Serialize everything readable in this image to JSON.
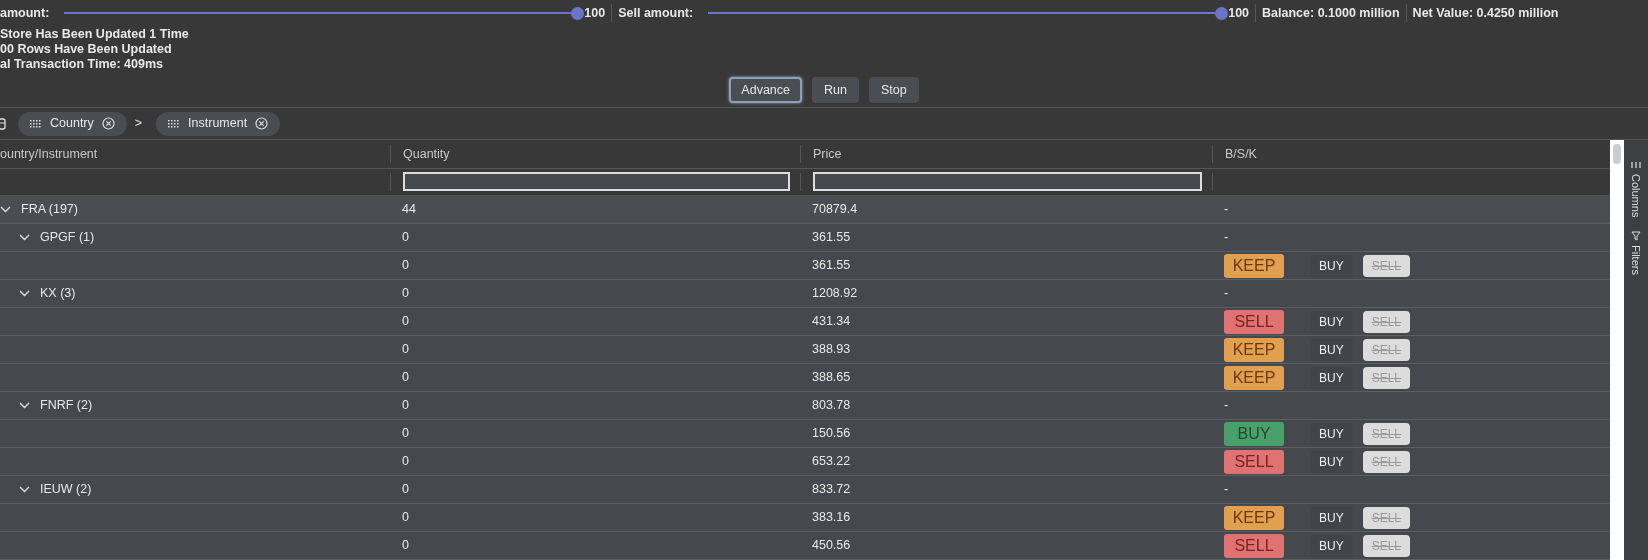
{
  "controls": {
    "buy_slider": {
      "label": "amount:",
      "level": 1,
      "value": "100"
    },
    "sell_slider": {
      "label": "Sell amount:",
      "level": 1,
      "value": "100"
    },
    "balance": "Balance: 0.1000 million",
    "net_value": "Net Value: 0.4250 million"
  },
  "status_lines": [
    "Store Has Been Updated 1 Time",
    "00 Rows Have Been Updated",
    "al Transaction Time: 409ms"
  ],
  "buttons": [
    {
      "label": "Advance",
      "focused": true
    },
    {
      "label": "Run",
      "focused": false
    },
    {
      "label": "Stop",
      "focused": false
    }
  ],
  "group_chips": [
    {
      "label": "Country"
    },
    {
      "label": "Instrument"
    }
  ],
  "group_separator": ">",
  "table": {
    "columns": [
      "ountry/Instrument",
      "Quantity",
      "Price",
      "B/S/K"
    ],
    "filters": [
      {
        "kind": "none"
      },
      {
        "kind": "text"
      },
      {
        "kind": "text"
      },
      {
        "kind": "none"
      }
    ],
    "rows": [
      {
        "label": "FRA (197)",
        "expanded": true,
        "quantity": "44",
        "price": "70879.4",
        "decision": "-",
        "children": [
          {
            "label": "GPGF (1)",
            "expanded": true,
            "quantity": "0",
            "price": "361.55",
            "decision": "-",
            "children": [
              {
                "quantity": "0",
                "price": "361.55",
                "decision": "KEEP",
                "kind": "keep",
                "buy": {
                  "label": "BUY",
                  "disabled": false
                },
                "sell": {
                  "label": "SELL",
                  "disabled": true
                }
              }
            ]
          },
          {
            "label": "KX (3)",
            "expanded": true,
            "quantity": "0",
            "price": "1208.92",
            "decision": "-",
            "children": [
              {
                "quantity": "0",
                "price": "431.34",
                "decision": "SELL",
                "kind": "sell",
                "buy": {
                  "label": "BUY",
                  "disabled": false
                },
                "sell": {
                  "label": "SELL",
                  "disabled": true
                }
              },
              {
                "quantity": "0",
                "price": "388.93",
                "decision": "KEEP",
                "kind": "keep",
                "buy": {
                  "label": "BUY",
                  "disabled": false
                },
                "sell": {
                  "label": "SELL",
                  "disabled": true
                }
              },
              {
                "quantity": "0",
                "price": "388.65",
                "decision": "KEEP",
                "kind": "keep",
                "buy": {
                  "label": "BUY",
                  "disabled": false
                },
                "sell": {
                  "label": "SELL",
                  "disabled": true
                }
              }
            ]
          },
          {
            "label": "FNRF (2)",
            "expanded": true,
            "quantity": "0",
            "price": "803.78",
            "decision": "-",
            "children": [
              {
                "quantity": "0",
                "price": "150.56",
                "decision": "BUY",
                "kind": "buy",
                "buy": {
                  "label": "BUY",
                  "disabled": false
                },
                "sell": {
                  "label": "SELL",
                  "disabled": true
                }
              },
              {
                "quantity": "0",
                "price": "653.22",
                "decision": "SELL",
                "kind": "sell",
                "buy": {
                  "label": "BUY",
                  "disabled": false
                },
                "sell": {
                  "label": "SELL",
                  "disabled": true
                }
              }
            ]
          },
          {
            "label": "IEUW (2)",
            "expanded": true,
            "quantity": "0",
            "price": "833.72",
            "decision": "-",
            "children": [
              {
                "quantity": "0",
                "price": "383.16",
                "decision": "KEEP",
                "kind": "keep",
                "buy": {
                  "label": "BUY",
                  "disabled": false
                },
                "sell": {
                  "label": "SELL",
                  "disabled": true
                }
              },
              {
                "quantity": "0",
                "price": "450.56",
                "decision": "SELL",
                "kind": "sell",
                "buy": {
                  "label": "BUY",
                  "disabled": false
                },
                "sell": {
                  "label": "SELL",
                  "disabled": true
                }
              }
            ]
          }
        ]
      }
    ]
  },
  "side_panel": [
    "Columns",
    "Filters"
  ]
}
